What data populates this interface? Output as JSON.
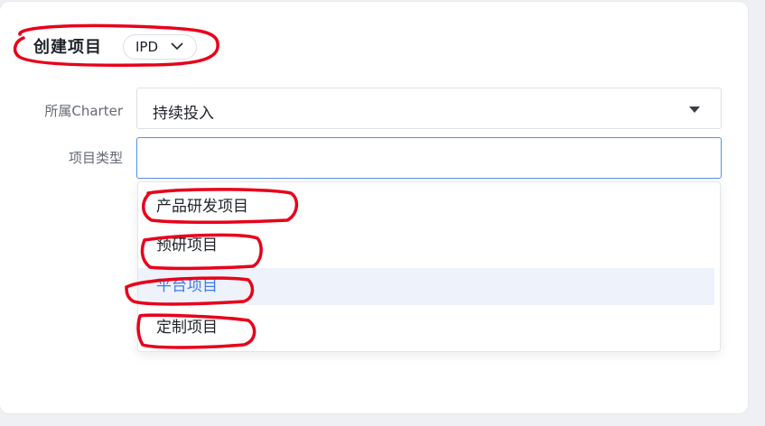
{
  "form": {
    "title": "创建项目",
    "project_type_pill": "IPD",
    "charter_label": "所属Charter",
    "charter_value": "持续投入",
    "type_label": "项目类型",
    "type_value": ""
  },
  "dropdown": {
    "options": [
      "产品研发项目",
      "预研项目",
      "平台项目",
      "定制项目"
    ],
    "highlighted_index": 2
  },
  "colors": {
    "annotation": "#e8001a",
    "accent": "#3d7bf4",
    "focus_border": "#5a8de8"
  }
}
